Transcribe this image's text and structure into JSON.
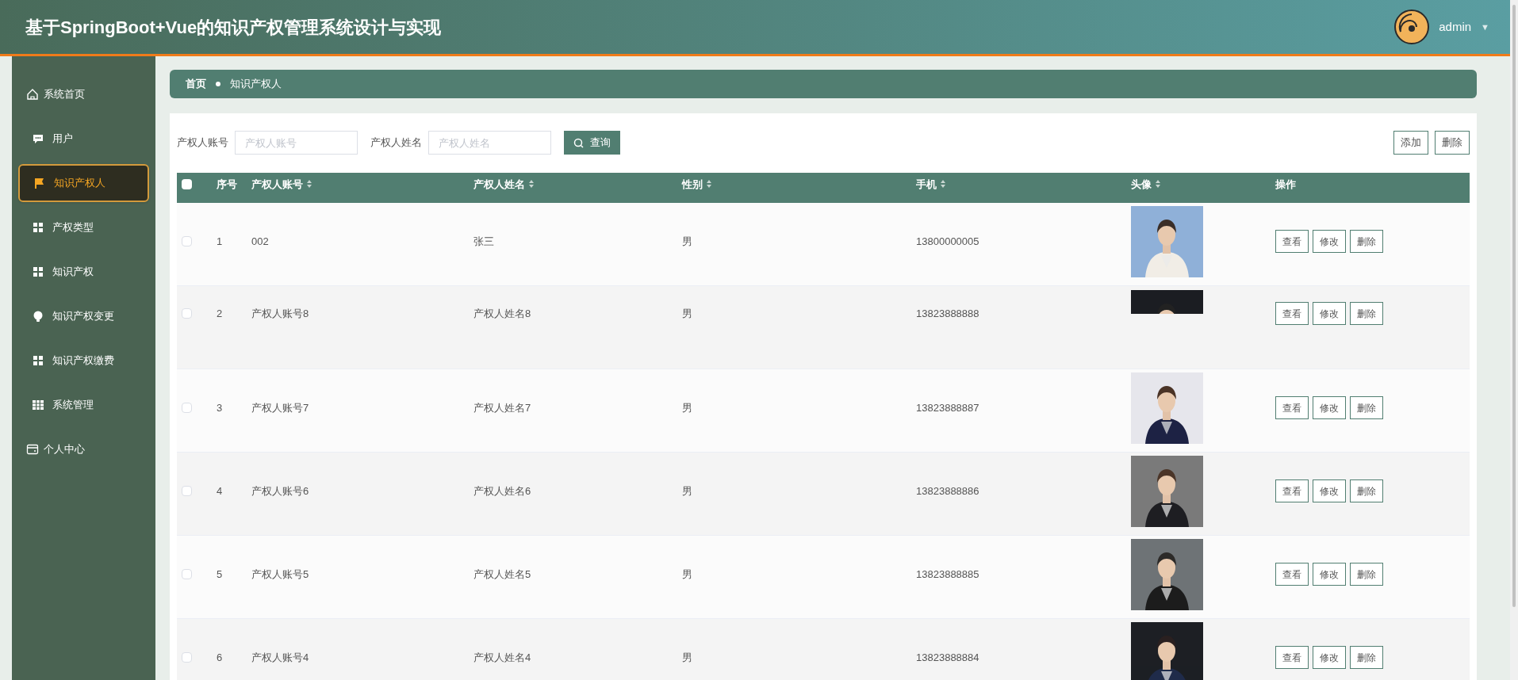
{
  "header": {
    "title": "基于SpringBoot+Vue的知识产权管理系统设计与实现",
    "user": {
      "name": "admin",
      "caret": "▼"
    }
  },
  "sidebar": {
    "items": [
      {
        "label": "系统首页",
        "kind": "home",
        "selected": false
      },
      {
        "label": "用户",
        "kind": "chat",
        "selected": false
      },
      {
        "label": "知识产权人",
        "kind": "flag",
        "selected": true
      },
      {
        "label": "产权类型",
        "kind": "grid",
        "selected": false
      },
      {
        "label": "知识产权",
        "kind": "grid",
        "selected": false
      },
      {
        "label": "知识产权变更",
        "kind": "bulb",
        "selected": false
      },
      {
        "label": "知识产权缴费",
        "kind": "grid",
        "selected": false
      },
      {
        "label": "系统管理",
        "kind": "table",
        "selected": false
      },
      {
        "label": "个人中心",
        "kind": "card",
        "selected": false
      }
    ]
  },
  "breadcrumb": [
    "首页",
    "知识产权人"
  ],
  "search": {
    "fields": [
      {
        "label": "产权人账号",
        "placeholder": "产权人账号"
      },
      {
        "label": "产权人姓名",
        "placeholder": "产权人姓名"
      }
    ],
    "button": "查询"
  },
  "actions": [
    "添加",
    "删除"
  ],
  "table": {
    "select_all": {
      "checked": false
    },
    "columns": [
      {
        "label": "序号",
        "sortable": false
      },
      {
        "label": "产权人账号",
        "sortable": true
      },
      {
        "label": "产权人姓名",
        "sortable": true
      },
      {
        "label": "性别",
        "sortable": true
      },
      {
        "label": "手机",
        "sortable": true
      },
      {
        "label": "头像",
        "sortable": true
      },
      {
        "label": "操作",
        "sortable": false
      }
    ],
    "rows": [
      {
        "checked": false,
        "index": "1",
        "account": "002",
        "name": "张三",
        "gender": "男",
        "phone": "13800000005",
        "buttons": [
          "查看",
          "修改",
          "删除"
        ]
      },
      {
        "checked": false,
        "index": "2",
        "account": "产权人账号8",
        "name": "产权人姓名8",
        "gender": "男",
        "phone": "13823888888",
        "avatar": {
          "kind": "partial"
        },
        "buttons": [
          "查看",
          "修改",
          "删除"
        ]
      },
      {
        "checked": false,
        "index": "3",
        "account": "产权人账号7",
        "name": "产权人姓名7",
        "gender": "男",
        "phone": "13823888887",
        "buttons": [
          "查看",
          "修改",
          "删除"
        ]
      },
      {
        "checked": false,
        "index": "4",
        "account": "产权人账号6",
        "name": "产权人姓名6",
        "gender": "男",
        "phone": "13823888886",
        "buttons": [
          "查看",
          "修改",
          "删除"
        ]
      },
      {
        "checked": false,
        "index": "5",
        "account": "产权人账号5",
        "name": "产权人姓名5",
        "gender": "男",
        "phone": "13823888885",
        "buttons": [
          "查看",
          "修改",
          "删除"
        ]
      },
      {
        "checked": false,
        "index": "6",
        "account": "产权人账号4",
        "name": "产权人姓名4",
        "gender": "男",
        "phone": "13823888884",
        "buttons": [
          "查看",
          "修改",
          "删除"
        ]
      }
    ]
  }
}
